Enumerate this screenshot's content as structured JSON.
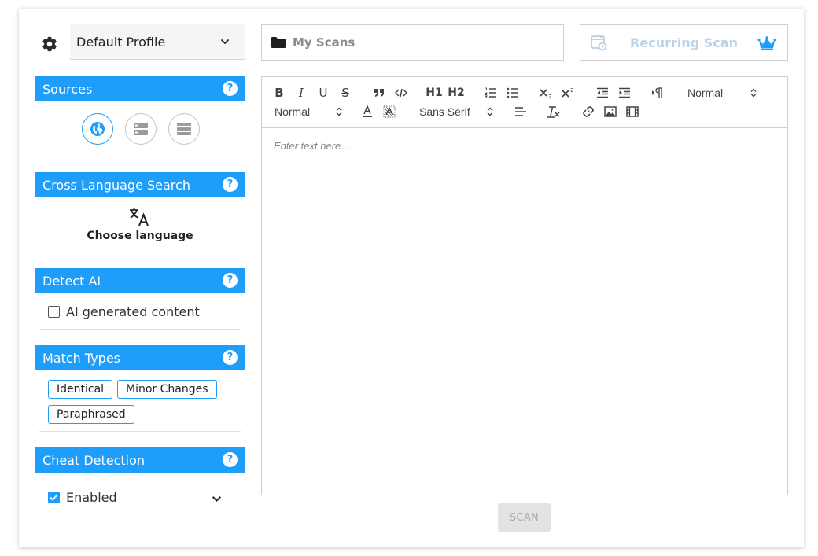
{
  "profile": {
    "selected": "Default Profile"
  },
  "sources": {
    "title": "Sources",
    "help": "?",
    "buttons": [
      {
        "icon": "globe-icon",
        "active": true
      },
      {
        "icon": "database-icon",
        "active": false
      },
      {
        "icon": "list-icon",
        "active": false
      }
    ]
  },
  "cross_language": {
    "title": "Cross Language Search",
    "help": "?",
    "choose_label": "Choose language"
  },
  "detect_ai": {
    "title": "Detect AI",
    "help": "?",
    "checkbox_label": "AI generated content",
    "checked": false
  },
  "match_types": {
    "title": "Match Types",
    "help": "?",
    "tags": [
      "Identical",
      "Minor Changes",
      "Paraphrased"
    ]
  },
  "cheat_detection": {
    "title": "Cheat Detection",
    "help": "?",
    "checkbox_label": "Enabled",
    "checked": true
  },
  "top_bar": {
    "my_scans": "My Scans",
    "recurring_scan": "Recurring Scan"
  },
  "editor": {
    "toolbar": {
      "heading1": "H1",
      "heading2": "H2",
      "header_select": "Normal",
      "size_select": "Normal",
      "font_select": "Sans Serif"
    },
    "placeholder": "Enter text here..."
  },
  "scan_button": "SCAN",
  "colors": {
    "accent": "#1f9dfa",
    "recurring_text": "#b9d3ea",
    "crown": "#1f9dfa"
  }
}
